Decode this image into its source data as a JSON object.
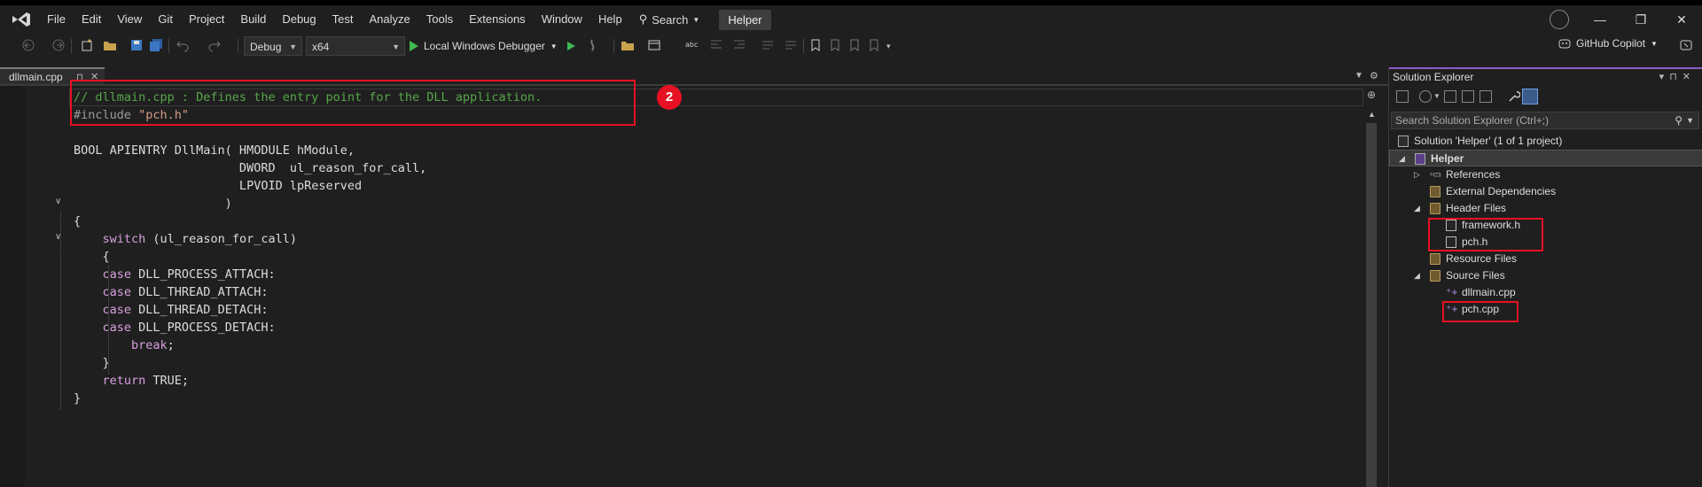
{
  "menu": {
    "items": [
      "File",
      "Edit",
      "View",
      "Git",
      "Project",
      "Build",
      "Debug",
      "Test",
      "Analyze",
      "Tools",
      "Extensions",
      "Window",
      "Help"
    ],
    "search_label": "Search",
    "solution_name": "Helper"
  },
  "window": {
    "minimize": "—",
    "restore": "❐",
    "close": "✕"
  },
  "toolbar": {
    "config": "Debug",
    "platform": "x64",
    "debugger_label": "Local Windows Debugger",
    "copilot_label": "GitHub Copilot"
  },
  "editor": {
    "tab_name": "dllmain.cpp",
    "tab_pin": "⊓",
    "tab_close": "✕",
    "code_lines": [
      {
        "parts": [
          {
            "t": "// dllmain.cpp : Defines the entry point for the DLL application.",
            "c": "cm"
          }
        ]
      },
      {
        "parts": [
          {
            "t": "#include ",
            "c": "pp"
          },
          {
            "t": "\"pch.h\"",
            "c": "str"
          }
        ]
      },
      {
        "parts": []
      },
      {
        "parts": [
          {
            "t": "BOOL APIENTRY DllMain( HMODULE hModule,",
            "c": "ident"
          }
        ]
      },
      {
        "parts": [
          {
            "t": "                       DWORD  ul_reason_for_call,",
            "c": "ident"
          }
        ]
      },
      {
        "parts": [
          {
            "t": "                       LPVOID lpReserved",
            "c": "ident"
          }
        ]
      },
      {
        "parts": [
          {
            "t": "                     )",
            "c": "ident"
          }
        ]
      },
      {
        "parts": [
          {
            "t": "{",
            "c": "ident"
          }
        ]
      },
      {
        "parts": [
          {
            "t": "    ",
            "c": "ident"
          },
          {
            "t": "switch",
            "c": "kw"
          },
          {
            "t": " (ul_reason_for_call)",
            "c": "ident"
          }
        ]
      },
      {
        "parts": [
          {
            "t": "    {",
            "c": "ident"
          }
        ]
      },
      {
        "parts": [
          {
            "t": "    ",
            "c": "ident"
          },
          {
            "t": "case",
            "c": "kw"
          },
          {
            "t": " DLL_PROCESS_ATTACH:",
            "c": "ident"
          }
        ]
      },
      {
        "parts": [
          {
            "t": "    ",
            "c": "ident"
          },
          {
            "t": "case",
            "c": "kw"
          },
          {
            "t": " DLL_THREAD_ATTACH:",
            "c": "ident"
          }
        ]
      },
      {
        "parts": [
          {
            "t": "    ",
            "c": "ident"
          },
          {
            "t": "case",
            "c": "kw"
          },
          {
            "t": " DLL_THREAD_DETACH:",
            "c": "ident"
          }
        ]
      },
      {
        "parts": [
          {
            "t": "    ",
            "c": "ident"
          },
          {
            "t": "case",
            "c": "kw"
          },
          {
            "t": " DLL_PROCESS_DETACH:",
            "c": "ident"
          }
        ]
      },
      {
        "parts": [
          {
            "t": "        ",
            "c": "ident"
          },
          {
            "t": "break",
            "c": "kw"
          },
          {
            "t": ";",
            "c": "ident"
          }
        ]
      },
      {
        "parts": [
          {
            "t": "    }",
            "c": "ident"
          }
        ]
      },
      {
        "parts": [
          {
            "t": "    ",
            "c": "ident"
          },
          {
            "t": "return",
            "c": "kw"
          },
          {
            "t": " TRUE;",
            "c": "ident"
          }
        ]
      },
      {
        "parts": [
          {
            "t": "}",
            "c": "ident"
          }
        ]
      }
    ],
    "annotation_badge": "2"
  },
  "solution_explorer": {
    "title": "Solution Explorer",
    "search_placeholder": "Search Solution Explorer (Ctrl+;)",
    "solution_label": "Solution 'Helper' (1 of 1 project)",
    "project": "Helper",
    "references": "References",
    "external_deps": "External Dependencies",
    "header_files": "Header Files",
    "header_items": [
      "framework.h",
      "pch.h"
    ],
    "resource_files": "Resource Files",
    "source_files": "Source Files",
    "source_items": [
      "dllmain.cpp",
      "pch.cpp"
    ]
  },
  "colors": {
    "annotation": "#e81123",
    "accent": "#8a5cc7",
    "comment": "#57a64a",
    "keyword": "#d8a0df",
    "string": "#d69d85"
  }
}
